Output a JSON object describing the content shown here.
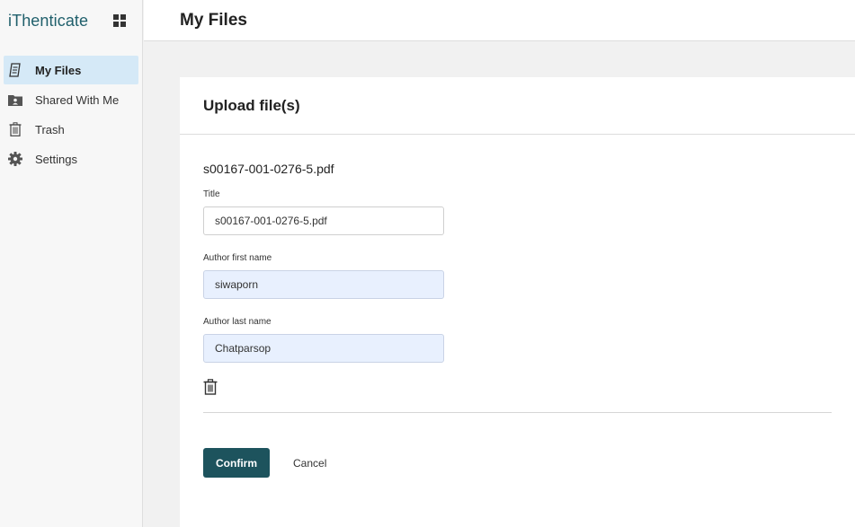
{
  "brand": {
    "name": "iThenticate"
  },
  "sidebar": {
    "items": [
      {
        "label": "My Files",
        "icon": "my-files-icon",
        "active": true
      },
      {
        "label": "Shared With Me",
        "icon": "shared-folder-icon",
        "active": false
      },
      {
        "label": "Trash",
        "icon": "trash-icon",
        "active": false
      },
      {
        "label": "Settings",
        "icon": "gear-icon",
        "active": false
      }
    ]
  },
  "header": {
    "title": "My Files"
  },
  "upload": {
    "title": "Upload file(s)",
    "file_name": "s00167-001-0276-5.pdf",
    "fields": {
      "title": {
        "label": "Title",
        "value": "s00167-001-0276-5.pdf"
      },
      "first_name": {
        "label": "Author first name",
        "value": "siwaporn"
      },
      "last_name": {
        "label": "Author last name",
        "value": "Chatparsop"
      }
    },
    "confirm_label": "Confirm",
    "cancel_label": "Cancel"
  },
  "colors": {
    "brand": "#1f5f6b",
    "active_nav": "#d5e9f7",
    "confirm": "#1d535d",
    "autofill": "#e8f0fe"
  }
}
